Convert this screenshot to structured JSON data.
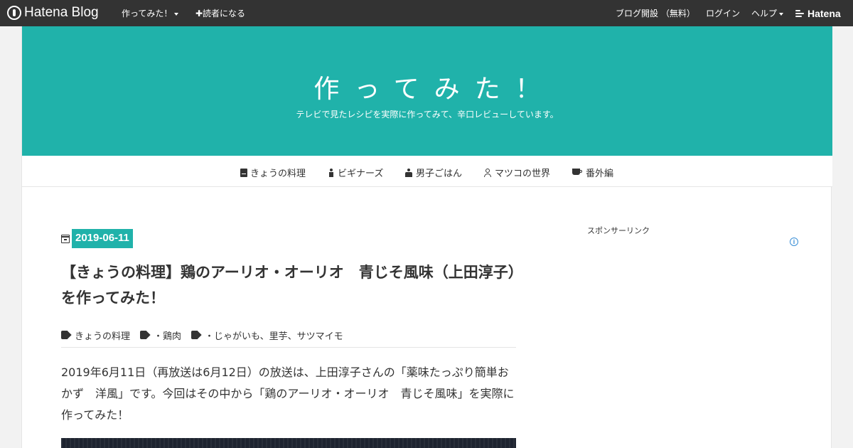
{
  "topbar": {
    "logo_text": "Hatena Blog",
    "blog_menu": "作ってみた！",
    "subscribe": "✚読者になる",
    "open_blog": "ブログ開設 （無料）",
    "login": "ログイン",
    "help": "ヘルプ",
    "hatena": "Hatena"
  },
  "header": {
    "title": "作ってみた！",
    "description": "テレビで見たレシピを実際に作ってみて、辛口レビューしています。",
    "color": "#20b2aa"
  },
  "catnav": {
    "items": [
      {
        "label": "きょうの料理",
        "icon": "book-icon"
      },
      {
        "label": "ビギナーズ",
        "icon": "child-icon"
      },
      {
        "label": "男子ごはん",
        "icon": "male-icon"
      },
      {
        "label": "マツコの世界",
        "icon": "user-icon"
      },
      {
        "label": "番外編",
        "icon": "coffee-icon"
      }
    ]
  },
  "article": {
    "date": "2019-06-11",
    "title": "【きょうの料理】鶏のアーリオ・オーリオ　青じそ風味（上田淳子）を作ってみた！",
    "tags": [
      "きょうの料理",
      "・鶏肉",
      "・じゃがいも、里芋、サツマイモ"
    ],
    "body": "2019年6月11日（再放送は6月12日）の放送は、上田淳子さんの「薬味たっぷり簡単おかず　洋風」です。今回はその中から「鶏のアーリオ・オーリオ　青じそ風味」を実際に作ってみた！"
  },
  "sidebar": {
    "sponsor_label": "スポンサーリンク",
    "ad_info": "i"
  }
}
